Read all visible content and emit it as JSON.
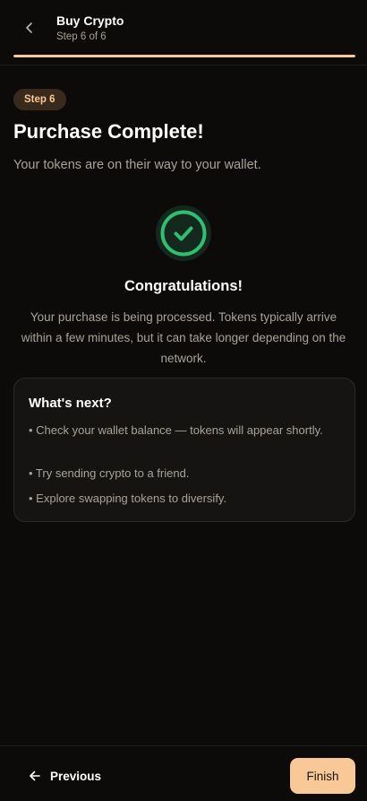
{
  "header": {
    "title": "Buy Crypto",
    "step_label": "Step 6 of 6",
    "progress": 1.0
  },
  "step_badge": "Step 6",
  "page_title": "Purchase Complete!",
  "page_subtitle": "Your tokens are on their way to your wallet.",
  "success": {
    "heading": "Congratulations!",
    "message": "Your purchase is being processed. Tokens typically arrive within a few minutes, but it can take longer depending on the network."
  },
  "next_steps": {
    "title": "What's next?",
    "items": [
      "• Check your wallet balance — tokens will appear shortly.",
      "• Try sending crypto to a friend.",
      "• Explore swapping tokens to diversify."
    ]
  },
  "footer": {
    "previous_label": "Previous",
    "finish_label": "Finish"
  },
  "colors": {
    "accent": "#f8c896",
    "success": "#2fbf71",
    "background": "#0d0b0a"
  },
  "icons": {
    "back": "chevron-left-icon",
    "success": "check-circle-icon",
    "previous": "arrow-left-icon"
  }
}
